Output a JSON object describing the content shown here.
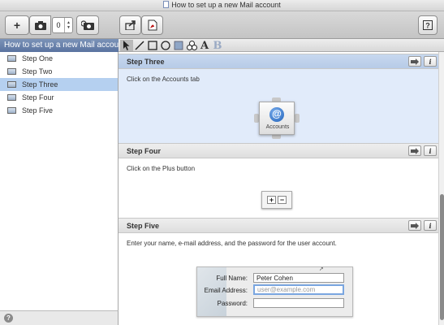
{
  "window": {
    "title": "How to set up a new Mail account"
  },
  "toolbar": {
    "add_label": "+",
    "stepper_value": "0"
  },
  "sidebar": {
    "header": "How to set up a new Mail account",
    "items": [
      {
        "label": "Step One"
      },
      {
        "label": "Step Two"
      },
      {
        "label": "Step Three"
      },
      {
        "label": "Step Four"
      },
      {
        "label": "Step Five"
      }
    ],
    "help_label": "?"
  },
  "drawtools": {
    "text_a": "A",
    "text_b": "B"
  },
  "steps": [
    {
      "title": "Step Three",
      "instruction": "Click on the Accounts tab",
      "icon_label": "Accounts"
    },
    {
      "title": "Step Four",
      "instruction": "Click on the Plus button",
      "plus": "+",
      "minus": "−"
    },
    {
      "title": "Step Five",
      "instruction": "Enter your name, e-mail address, and the password for the user account."
    }
  ],
  "form": {
    "fullname_label": "Full Name:",
    "fullname_value": "Peter Cohen",
    "email_label": "Email Address:",
    "email_placeholder": "user@example.com",
    "password_label": "Password:"
  },
  "info_label": "i"
}
